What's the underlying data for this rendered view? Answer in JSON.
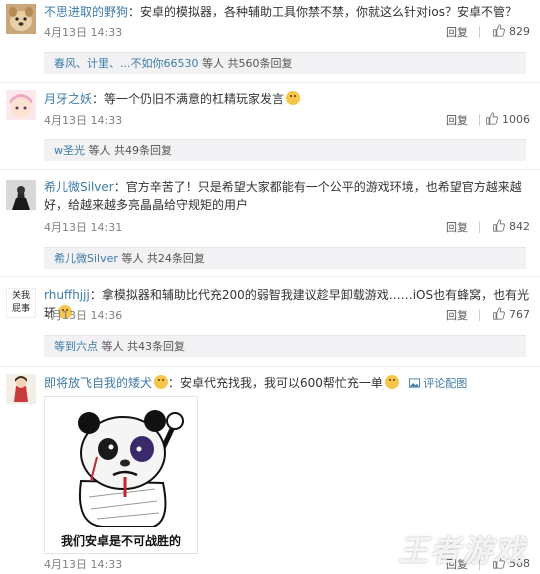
{
  "comments": [
    {
      "author": "不思进取的野狗",
      "text": "：安卓的模拟器，各种辅助工具你禁不禁，你就这么针对ios？安卓不管？",
      "time": "4月13日 14:33",
      "reply_label": "回复",
      "likes": "829",
      "sub": {
        "names": "春风、计里、...不如你66530",
        "count_text": " 等人 共560条回复"
      }
    },
    {
      "author": "月牙之妖",
      "text": "：等一个仍旧不满意的杠精玩家发言",
      "time": "4月13日 14:33",
      "reply_label": "回复",
      "likes": "1006",
      "sub": {
        "names": "w圣光",
        "count_text": " 等人 共49条回复"
      }
    },
    {
      "author": "希儿微Silver",
      "text": "：官方辛苦了！只是希望大家都能有一个公平的游戏环境，也希望官方越来越好，给越来越多亮晶晶给守规矩的用户",
      "time": "4月13日 14:31",
      "reply_label": "回复",
      "likes": "842",
      "sub": {
        "names": "希儿微Silver",
        "count_text": " 等人 共24条回复"
      }
    },
    {
      "author": "rhuffhjjj",
      "avatar_text": "关我 屁事",
      "text": "：拿模拟器和辅助比代充200的弱智我建议趁早卸载游戏……iOS也有蜂窝，也有光环",
      "time": "4月13日 14:36",
      "reply_label": "回复",
      "likes": "767",
      "sub": {
        "names": "等到六点",
        "count_text": " 等人 共43条回复"
      }
    },
    {
      "author": "即将放飞自我的矮犬",
      "text": "：安卓代充找我，我可以600帮忙充一单",
      "pic_link": "评论配图",
      "meme_caption": "我们安卓是不可战胜的",
      "time": "4月13日 14:33",
      "reply_label": "回复",
      "likes": "568"
    }
  ],
  "icons": {
    "like": "thumbs-up-icon",
    "pic": "image-icon"
  },
  "watermark": "王者游戏",
  "colors": {
    "author": "#eb7350",
    "link": "#3d7ba8",
    "subbox_bg": "#f2f2f5"
  }
}
